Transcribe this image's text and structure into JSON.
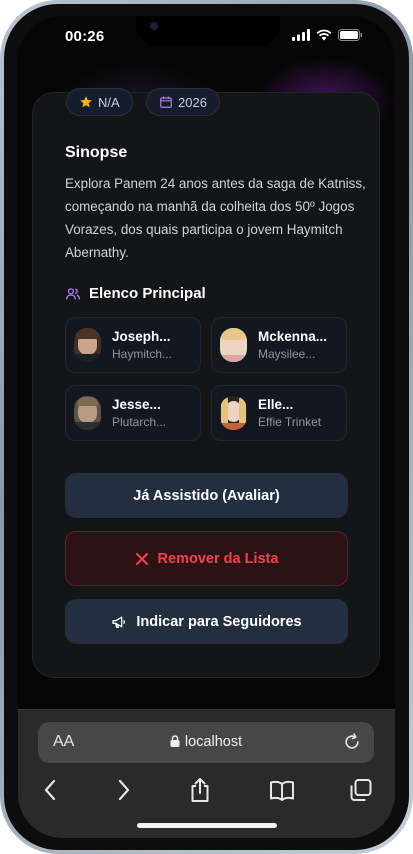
{
  "status_bar": {
    "time": "00:26"
  },
  "chips": {
    "rating": "N/A",
    "year": "2026"
  },
  "synopsis": {
    "title": "Sinopse",
    "text": "Explora Panem 24 anos antes da saga de Katniss, começando na manhã da colheita dos 50º Jogos Vorazes, dos quais participa o jovem Haymitch Abernathy."
  },
  "cast": {
    "title": "Elenco Principal",
    "members": [
      {
        "name": "Joseph...",
        "role": "Haymitch..."
      },
      {
        "name": "Mckenna...",
        "role": "Maysilee..."
      },
      {
        "name": "Jesse...",
        "role": "Plutarch..."
      },
      {
        "name": "Elle...",
        "role": "Effie Trinket"
      }
    ]
  },
  "actions": {
    "watched": "Já Assistido (Avaliar)",
    "remove": "Remover da Lista",
    "recommend": "Indicar para Seguidores"
  },
  "browser": {
    "text_size": "AA",
    "url": "localhost"
  },
  "colors": {
    "accent_red": "#f34150",
    "star": "#f5b50a",
    "calendar": "#b57bf0",
    "people": "#b57bf0"
  }
}
